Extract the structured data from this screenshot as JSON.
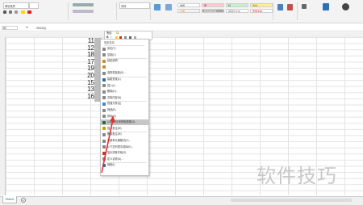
{
  "ribbon": {
    "font_name": "微软雅黑",
    "number_format": "常规",
    "styles": [
      {
        "label": "常规",
        "bg": "#ffffff",
        "fg": "#333333"
      },
      {
        "label": "差",
        "bg": "#ffc7ce",
        "fg": "#9c0006"
      },
      {
        "label": "好",
        "bg": "#c6efce",
        "fg": "#006100"
      },
      {
        "label": "适中",
        "bg": "#ffeb9c",
        "fg": "#9c5700"
      },
      {
        "label": "计算",
        "bg": "#f2f2f2",
        "fg": "#fa7d00"
      },
      {
        "label": "检查单元格",
        "bg": "#a5a5a5",
        "fg": "#ffffff"
      },
      {
        "label": "解释性文本",
        "bg": "#ffffff",
        "fg": "#7f7f7f"
      },
      {
        "label": "警告文本",
        "bg": "#ffffff",
        "fg": "#ff0000"
      }
    ]
  },
  "formula_bar": {
    "name_box": "B2",
    "fx": "fx",
    "formula": "=RAND()"
  },
  "cells": {
    "values": [
      "11",
      "12",
      "18",
      "17",
      "19",
      "20",
      "15",
      "13",
      "16"
    ]
  },
  "mini_toolbar": {
    "font": "等线",
    "size": "11",
    "bold": "B",
    "italic": "I"
  },
  "context_menu": {
    "search_placeholder": "搜索菜单",
    "items": [
      {
        "label": "剪切(T)",
        "color": "#888888"
      },
      {
        "label": "复制(C)",
        "color": "#888888"
      },
      {
        "label": "粘贴选项:",
        "color": "#d08a30"
      },
      {
        "label": "",
        "color": "#d08a30"
      },
      {
        "label": "选择性粘贴(S)...",
        "color": "#888888"
      },
      {
        "label": "智能查找(L)",
        "color": "#2b6cb0"
      },
      {
        "label": "插入(I)...",
        "color": "#888888"
      },
      {
        "label": "删除(D)...",
        "color": "#888888"
      },
      {
        "label": "清除内容(N)",
        "color": "#888888"
      },
      {
        "label": "快速分析(Q)",
        "color": "#2f8fd8"
      },
      {
        "label": "筛选(E)",
        "color": "#888888"
      },
      {
        "label": "排序(O)",
        "color": "#888888"
      },
      {
        "label": "从表格/区域获取数据(G)...",
        "color": "#217346"
      },
      {
        "label": "插入批注(M)",
        "color": "#d0a000"
      },
      {
        "label": "删除批注(M)",
        "color": "#888888"
      },
      {
        "label": "设置单元格格式(F)...",
        "color": "#888888"
      },
      {
        "label": "从下拉列表中选择(K)...",
        "color": "#888888"
      },
      {
        "label": "显示拼音字段(S)",
        "color": "#c0392b"
      },
      {
        "label": "定义名称(A)...",
        "color": "#888888"
      },
      {
        "label": "链接(I)",
        "color": "#2b6cb0"
      }
    ]
  },
  "sheet_tabs": [
    "Sheet1"
  ],
  "watermark": "软件技巧"
}
